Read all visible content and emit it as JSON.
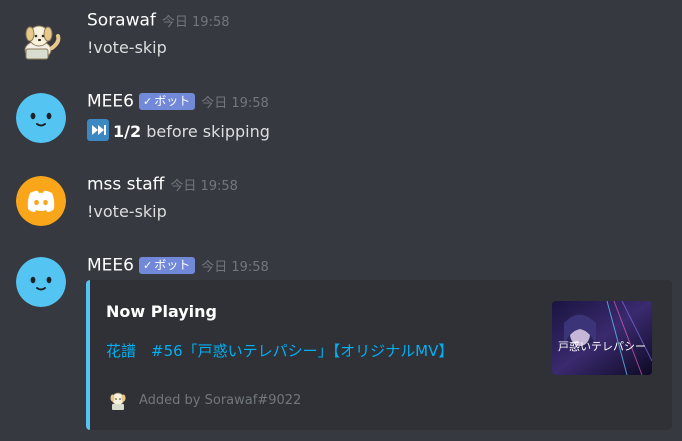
{
  "messages": [
    {
      "username": "Sorawaf",
      "timestamp": "今日 19:58",
      "text": "!vote-skip",
      "avatar_icon": "dog-avatar-icon"
    },
    {
      "username": "MEE6",
      "bot_tag": "ボット",
      "timestamp": "今日 19:58",
      "emoji_icon": "next-track-emoji-icon",
      "count_text": "1/2",
      "suffix_text": " before skipping",
      "avatar_icon": "mee6-avatar-icon"
    },
    {
      "username": "mss staff",
      "timestamp": "今日 19:58",
      "text": "!vote-skip",
      "avatar_icon": "discord-logo-avatar-icon"
    },
    {
      "username": "MEE6",
      "bot_tag": "ボット",
      "timestamp": "今日 19:58",
      "avatar_icon": "mee6-avatar-icon"
    }
  ],
  "embed": {
    "title": "Now Playing",
    "description": "花譜　#56「戸惑いテレパシー」【オリジナルMV】",
    "footer": "Added by Sorawaf#9022",
    "thumbnail_text": "戸惑いテレパシー",
    "accent_color": "#54c4f3"
  },
  "colors": {
    "background": "#36393f",
    "bot_tag": "#7289da",
    "mee6_avatar": "#54c4f3",
    "discord_avatar": "#faa61a",
    "link": "#00b0f4"
  }
}
